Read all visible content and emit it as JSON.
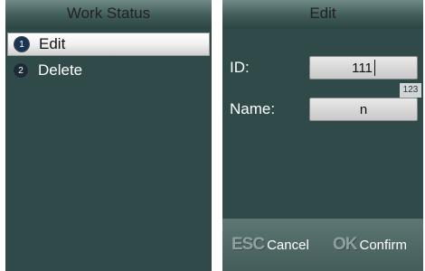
{
  "left_screen": {
    "title": "Work Status",
    "menu_items": [
      {
        "number": "1",
        "label": "Edit",
        "selected": true
      },
      {
        "number": "2",
        "label": "Delete",
        "selected": false
      }
    ]
  },
  "right_screen": {
    "title": "Edit",
    "fields": [
      {
        "label": "ID:",
        "value": "111"
      },
      {
        "label": "Name:",
        "value": "n"
      }
    ],
    "input_mode": "123",
    "footer": {
      "cancel_key": "ESC",
      "cancel_label": "Cancel",
      "confirm_key": "OK",
      "confirm_label": "Confirm"
    }
  }
}
